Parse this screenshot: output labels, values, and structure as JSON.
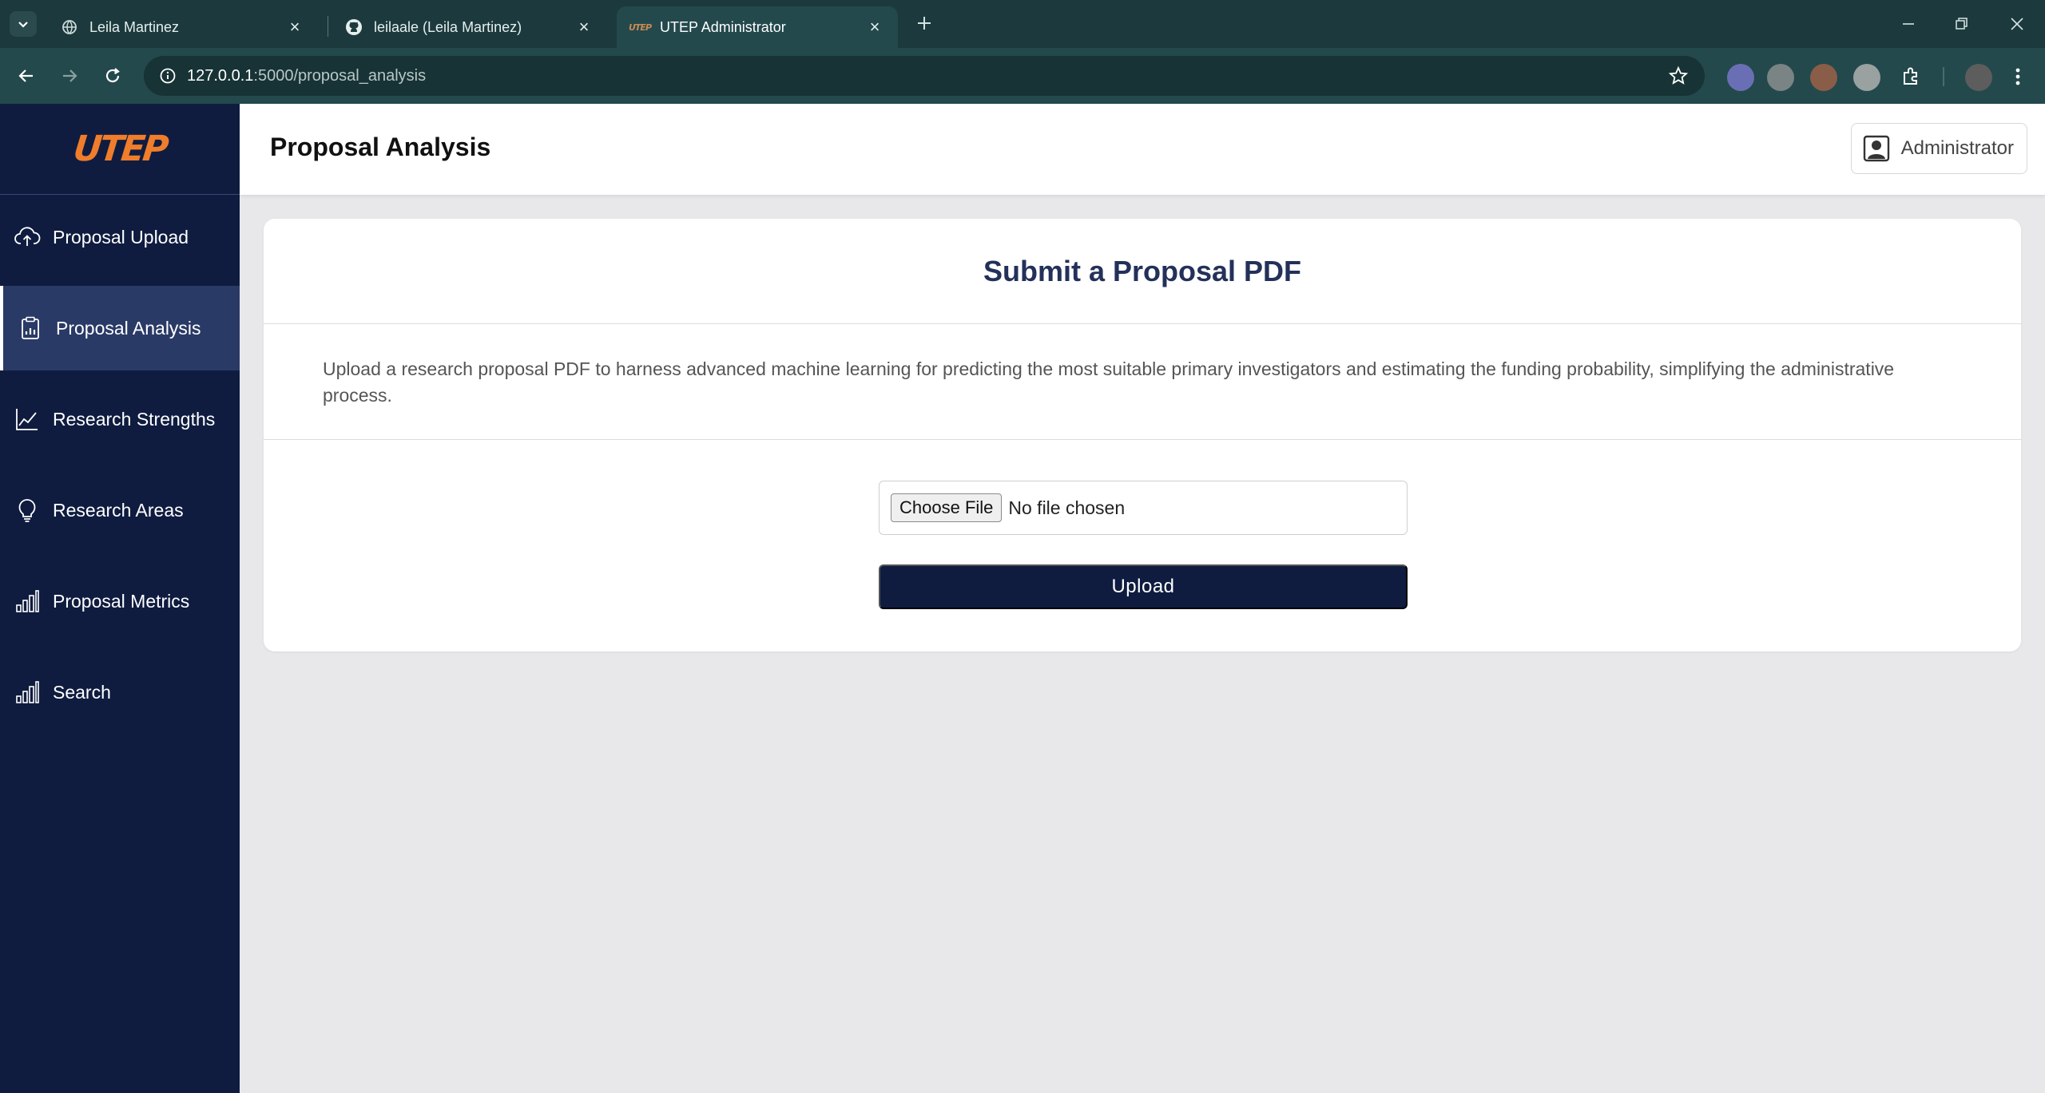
{
  "browser": {
    "tabs": [
      {
        "title": "Leila Martinez",
        "icon": "globe-icon"
      },
      {
        "title": "leilaale (Leila Martinez)",
        "icon": "github-icon"
      },
      {
        "title": "UTEP Administrator",
        "icon": "utep-favicon",
        "active": true
      }
    ],
    "url_host": "127.0.0.1",
    "url_path": ":5000/proposal_analysis"
  },
  "sidebar": {
    "logo_text": "UTEP",
    "items": [
      {
        "label": "Proposal Upload",
        "icon": "cloud-upload-icon"
      },
      {
        "label": "Proposal Analysis",
        "icon": "clipboard-chart-icon",
        "active": true
      },
      {
        "label": "Research Strengths",
        "icon": "line-chart-icon"
      },
      {
        "label": "Research Areas",
        "icon": "lightbulb-icon"
      },
      {
        "label": "Proposal Metrics",
        "icon": "bar-chart-icon"
      },
      {
        "label": "Search",
        "icon": "bar-chart-icon"
      }
    ]
  },
  "header": {
    "title": "Proposal Analysis",
    "user_label": "Administrator"
  },
  "main": {
    "card_title": "Submit a Proposal PDF",
    "description": "Upload a research proposal PDF to harness advanced machine learning for predicting the most suitable primary investigators and estimating the funding probability, simplifying the administrative process.",
    "file_button_label": "Choose File",
    "file_status": "No file chosen",
    "upload_label": "Upload"
  },
  "colors": {
    "sidebar_bg": "#0f1c40",
    "accent_orange": "#ef7d2c",
    "title_navy": "#23315a",
    "browser_frame": "#1c3a3d"
  }
}
